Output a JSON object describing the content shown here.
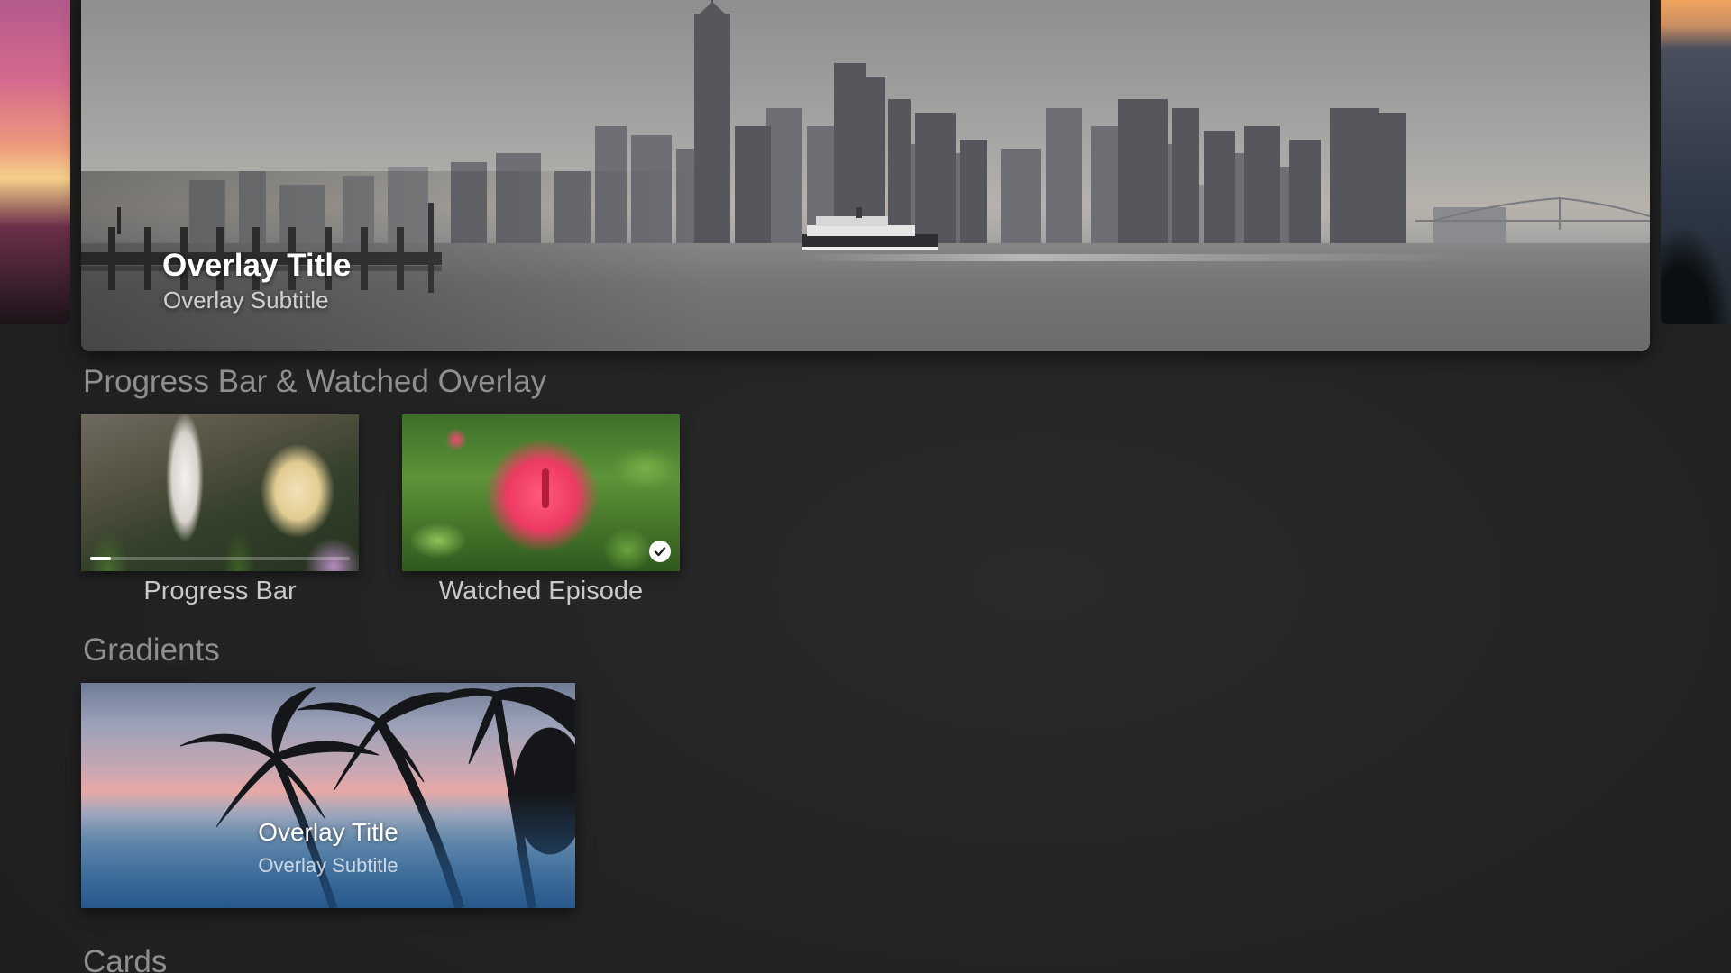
{
  "hero": {
    "overlay_title": "Overlay Title",
    "overlay_subtitle": "Overlay Subtitle"
  },
  "sections": {
    "progress_watched": "Progress Bar & Watched Overlay",
    "gradients": "Gradients",
    "cards": "Cards"
  },
  "progress_card": {
    "label": "Progress Bar",
    "progress_fraction": 0.08
  },
  "watched_card": {
    "label": "Watched Episode",
    "badge_icon": "checkmark-icon"
  },
  "gradient_card": {
    "overlay_title": "Overlay Title",
    "overlay_subtitle": "Overlay Subtitle"
  },
  "colors": {
    "background": "#232323",
    "section_title": "#8f8f8f",
    "label": "#c9c9c9"
  }
}
